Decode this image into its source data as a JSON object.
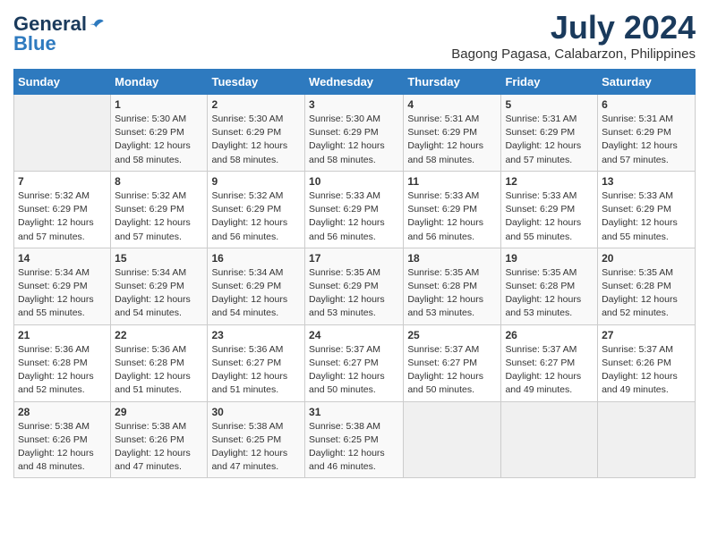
{
  "logo": {
    "line1": "General",
    "line2": "Blue"
  },
  "title": "July 2024",
  "location": "Bagong Pagasa, Calabarzon, Philippines",
  "days_header": [
    "Sunday",
    "Monday",
    "Tuesday",
    "Wednesday",
    "Thursday",
    "Friday",
    "Saturday"
  ],
  "weeks": [
    [
      {
        "day": "",
        "info": ""
      },
      {
        "day": "1",
        "info": "Sunrise: 5:30 AM\nSunset: 6:29 PM\nDaylight: 12 hours\nand 58 minutes."
      },
      {
        "day": "2",
        "info": "Sunrise: 5:30 AM\nSunset: 6:29 PM\nDaylight: 12 hours\nand 58 minutes."
      },
      {
        "day": "3",
        "info": "Sunrise: 5:30 AM\nSunset: 6:29 PM\nDaylight: 12 hours\nand 58 minutes."
      },
      {
        "day": "4",
        "info": "Sunrise: 5:31 AM\nSunset: 6:29 PM\nDaylight: 12 hours\nand 58 minutes."
      },
      {
        "day": "5",
        "info": "Sunrise: 5:31 AM\nSunset: 6:29 PM\nDaylight: 12 hours\nand 57 minutes."
      },
      {
        "day": "6",
        "info": "Sunrise: 5:31 AM\nSunset: 6:29 PM\nDaylight: 12 hours\nand 57 minutes."
      }
    ],
    [
      {
        "day": "7",
        "info": "Sunrise: 5:32 AM\nSunset: 6:29 PM\nDaylight: 12 hours\nand 57 minutes."
      },
      {
        "day": "8",
        "info": "Sunrise: 5:32 AM\nSunset: 6:29 PM\nDaylight: 12 hours\nand 57 minutes."
      },
      {
        "day": "9",
        "info": "Sunrise: 5:32 AM\nSunset: 6:29 PM\nDaylight: 12 hours\nand 56 minutes."
      },
      {
        "day": "10",
        "info": "Sunrise: 5:33 AM\nSunset: 6:29 PM\nDaylight: 12 hours\nand 56 minutes."
      },
      {
        "day": "11",
        "info": "Sunrise: 5:33 AM\nSunset: 6:29 PM\nDaylight: 12 hours\nand 56 minutes."
      },
      {
        "day": "12",
        "info": "Sunrise: 5:33 AM\nSunset: 6:29 PM\nDaylight: 12 hours\nand 55 minutes."
      },
      {
        "day": "13",
        "info": "Sunrise: 5:33 AM\nSunset: 6:29 PM\nDaylight: 12 hours\nand 55 minutes."
      }
    ],
    [
      {
        "day": "14",
        "info": "Sunrise: 5:34 AM\nSunset: 6:29 PM\nDaylight: 12 hours\nand 55 minutes."
      },
      {
        "day": "15",
        "info": "Sunrise: 5:34 AM\nSunset: 6:29 PM\nDaylight: 12 hours\nand 54 minutes."
      },
      {
        "day": "16",
        "info": "Sunrise: 5:34 AM\nSunset: 6:29 PM\nDaylight: 12 hours\nand 54 minutes."
      },
      {
        "day": "17",
        "info": "Sunrise: 5:35 AM\nSunset: 6:29 PM\nDaylight: 12 hours\nand 53 minutes."
      },
      {
        "day": "18",
        "info": "Sunrise: 5:35 AM\nSunset: 6:28 PM\nDaylight: 12 hours\nand 53 minutes."
      },
      {
        "day": "19",
        "info": "Sunrise: 5:35 AM\nSunset: 6:28 PM\nDaylight: 12 hours\nand 53 minutes."
      },
      {
        "day": "20",
        "info": "Sunrise: 5:35 AM\nSunset: 6:28 PM\nDaylight: 12 hours\nand 52 minutes."
      }
    ],
    [
      {
        "day": "21",
        "info": "Sunrise: 5:36 AM\nSunset: 6:28 PM\nDaylight: 12 hours\nand 52 minutes."
      },
      {
        "day": "22",
        "info": "Sunrise: 5:36 AM\nSunset: 6:28 PM\nDaylight: 12 hours\nand 51 minutes."
      },
      {
        "day": "23",
        "info": "Sunrise: 5:36 AM\nSunset: 6:27 PM\nDaylight: 12 hours\nand 51 minutes."
      },
      {
        "day": "24",
        "info": "Sunrise: 5:37 AM\nSunset: 6:27 PM\nDaylight: 12 hours\nand 50 minutes."
      },
      {
        "day": "25",
        "info": "Sunrise: 5:37 AM\nSunset: 6:27 PM\nDaylight: 12 hours\nand 50 minutes."
      },
      {
        "day": "26",
        "info": "Sunrise: 5:37 AM\nSunset: 6:27 PM\nDaylight: 12 hours\nand 49 minutes."
      },
      {
        "day": "27",
        "info": "Sunrise: 5:37 AM\nSunset: 6:26 PM\nDaylight: 12 hours\nand 49 minutes."
      }
    ],
    [
      {
        "day": "28",
        "info": "Sunrise: 5:38 AM\nSunset: 6:26 PM\nDaylight: 12 hours\nand 48 minutes."
      },
      {
        "day": "29",
        "info": "Sunrise: 5:38 AM\nSunset: 6:26 PM\nDaylight: 12 hours\nand 47 minutes."
      },
      {
        "day": "30",
        "info": "Sunrise: 5:38 AM\nSunset: 6:25 PM\nDaylight: 12 hours\nand 47 minutes."
      },
      {
        "day": "31",
        "info": "Sunrise: 5:38 AM\nSunset: 6:25 PM\nDaylight: 12 hours\nand 46 minutes."
      },
      {
        "day": "",
        "info": ""
      },
      {
        "day": "",
        "info": ""
      },
      {
        "day": "",
        "info": ""
      }
    ]
  ]
}
